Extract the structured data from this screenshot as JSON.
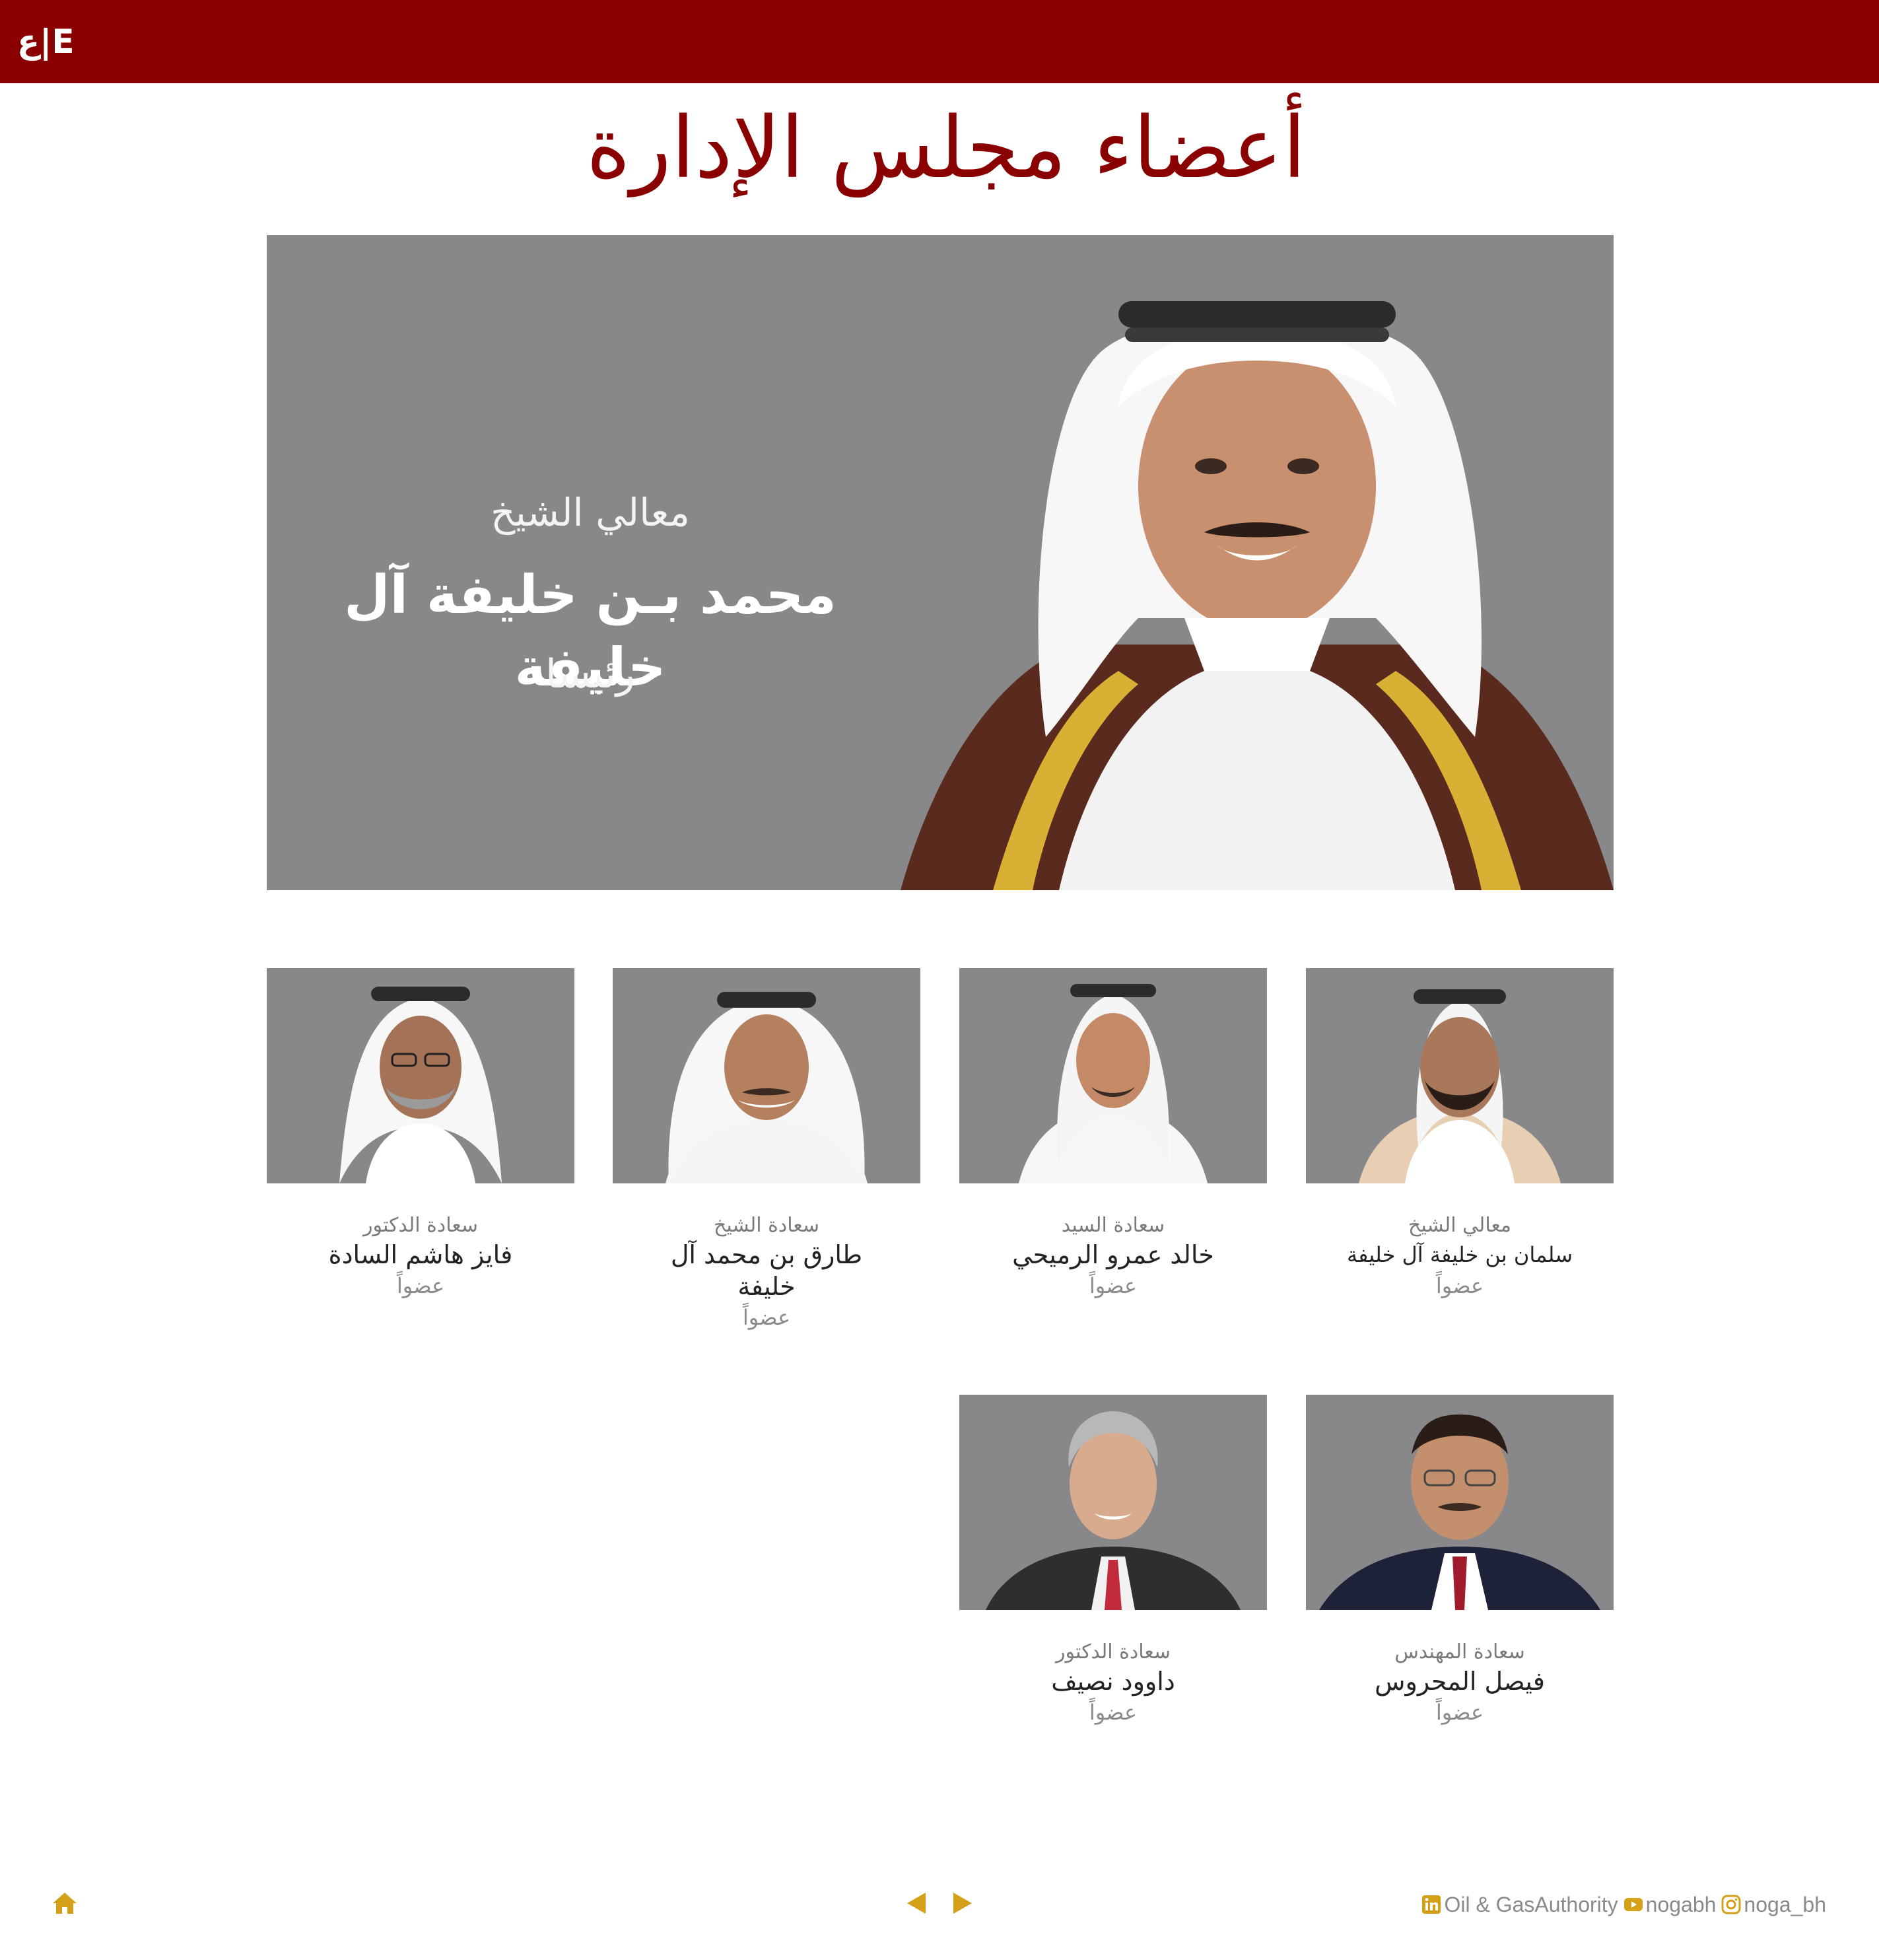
{
  "header": {
    "lang_switch": "ع|E"
  },
  "page_title": "أعضاء مجلس الإدارة",
  "chairman": {
    "honorific": "معالي الشيخ",
    "name": "محمد بـن خليفة آل خليفة",
    "role": "رئيسا"
  },
  "members": [
    {
      "honorific": "معالي الشيخ",
      "name": "سلمان بن خليفة آل خليفة",
      "role": "عضواً"
    },
    {
      "honorific": "سعادة السيد",
      "name": "خالد عمرو الرميحي",
      "role": "عضواً"
    },
    {
      "honorific": "سعادة الشيخ",
      "name": "طارق بن محمد آل خليفة",
      "role": "عضواً"
    },
    {
      "honorific": "سعادة الدكتور",
      "name": "فايز هاشم السادة",
      "role": "عضواً"
    },
    {
      "honorific": "سعادة المهندس",
      "name": "فيصل المحروس",
      "role": "عضواً"
    },
    {
      "honorific": "سعادة الدكتور",
      "name": "داوود نصيف",
      "role": "عضواً"
    }
  ],
  "footer": {
    "icons": {
      "home": "home-icon",
      "prev": "triangle-left-icon",
      "next": "triangle-right-icon",
      "linkedin": "linkedin-icon",
      "youtube": "youtube-icon",
      "instagram": "instagram-icon"
    },
    "social": {
      "linkedin_label": "Oil & GasAuthority",
      "youtube_label": "nogabh",
      "instagram_label": "noga_bh"
    }
  },
  "colors": {
    "brand_red": "#8a0000",
    "accent_gold": "#d4a017",
    "photo_bg": "#88888a"
  }
}
